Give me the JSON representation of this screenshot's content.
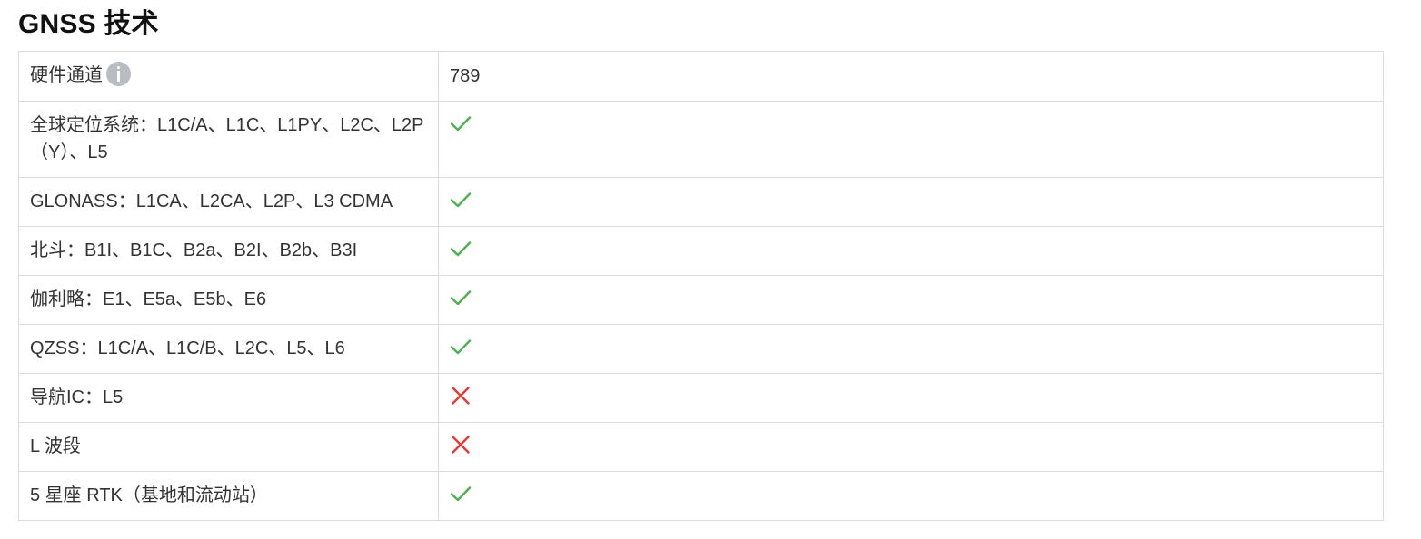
{
  "title": "GNSS 技术",
  "rows": [
    {
      "label": "硬件通道",
      "value": "789",
      "has_info": true
    },
    {
      "label": "全球定位系统：L1C/A、L1C、L1PY、L2C、L2P（Y）、L5",
      "status": "check"
    },
    {
      "label": "GLONASS：L1CA、L2CA、L2P、L3 CDMA",
      "status": "check"
    },
    {
      "label": "北斗：B1I、B1C、B2a、B2I、B2b、B3I",
      "status": "check"
    },
    {
      "label": "伽利略：E1、E5a、E5b、E6",
      "status": "check"
    },
    {
      "label": "QZSS：L1C/A、L1C/B、L2C、L5、L6",
      "status": "check"
    },
    {
      "label": "导航IC：L5",
      "status": "cross"
    },
    {
      "label": "L 波段",
      "status": "cross"
    },
    {
      "label": "5 星座 RTK（基地和流动站）",
      "status": "check"
    }
  ],
  "icons": {
    "info": "info-icon",
    "check": "check-icon",
    "cross": "cross-icon"
  },
  "colors": {
    "check": "#4caf50",
    "cross": "#e53935",
    "info": "#b9bcc0",
    "border": "#dcdcdc"
  }
}
